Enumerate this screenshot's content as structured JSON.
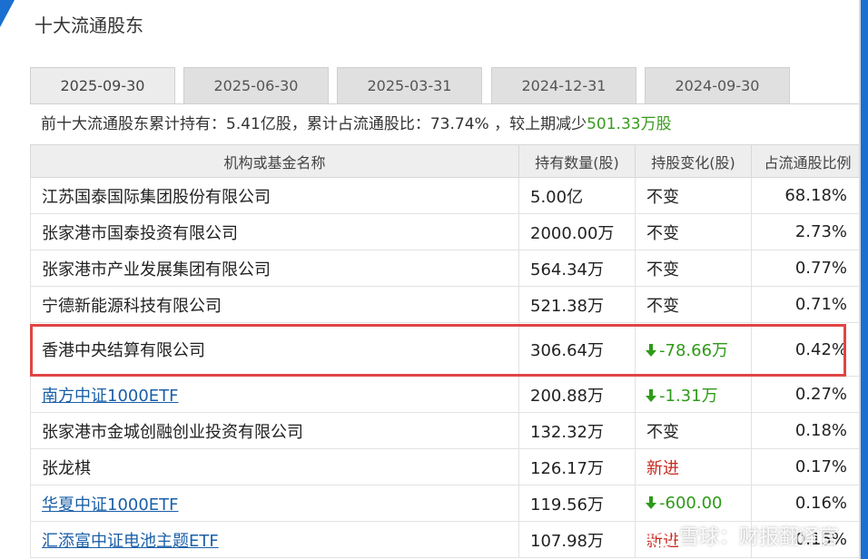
{
  "section_title": "十大流通股东",
  "tabs": [
    {
      "label": "2025-09-30",
      "active": true
    },
    {
      "label": "2025-06-30",
      "active": false
    },
    {
      "label": "2025-03-31",
      "active": false
    },
    {
      "label": "2024-12-31",
      "active": false
    },
    {
      "label": "2024-09-30",
      "active": false
    }
  ],
  "summary": {
    "prefix": "前十大流通股东累计持有：",
    "total_shares": "5.41亿股",
    "sep1": "，累计占流通股比：",
    "total_ratio": "73.74%",
    "sep2": " ，较上期减少",
    "decrease": "501.33万股"
  },
  "table": {
    "headers": [
      "机构或基金名称",
      "持有数量(股)",
      "持股变化(股)",
      "占流通股比例"
    ],
    "rows": [
      {
        "name": "江苏国泰国际集团股份有限公司",
        "link": false,
        "shares": "5.00亿",
        "change": "不变",
        "change_type": "same",
        "ratio": "68.18%"
      },
      {
        "name": "张家港市国泰投资有限公司",
        "link": false,
        "shares": "2000.00万",
        "change": "不变",
        "change_type": "same",
        "ratio": "2.73%"
      },
      {
        "name": "张家港市产业发展集团有限公司",
        "link": false,
        "shares": "564.34万",
        "change": "不变",
        "change_type": "same",
        "ratio": "0.77%"
      },
      {
        "name": "宁德新能源科技有限公司",
        "link": false,
        "shares": "521.38万",
        "change": "不变",
        "change_type": "same",
        "ratio": "0.71%"
      },
      {
        "name": "香港中央结算有限公司",
        "link": false,
        "shares": "306.64万",
        "change": "-78.66万",
        "change_type": "down",
        "ratio": "0.42%"
      },
      {
        "name": "南方中证1000ETF",
        "link": true,
        "shares": "200.88万",
        "change": "-1.31万",
        "change_type": "down",
        "ratio": "0.27%"
      },
      {
        "name": "张家港市金城创融创业投资有限公司",
        "link": false,
        "shares": "132.32万",
        "change": "不变",
        "change_type": "same",
        "ratio": "0.18%"
      },
      {
        "name": "张龙棋",
        "link": false,
        "shares": "126.17万",
        "change": "新进",
        "change_type": "new",
        "ratio": "0.17%"
      },
      {
        "name": "华夏中证1000ETF",
        "link": true,
        "shares": "119.56万",
        "change": "-600.00",
        "change_type": "down",
        "ratio": "0.16%"
      },
      {
        "name": "汇添富中证电池主题ETF",
        "link": true,
        "shares": "107.98万",
        "change": "新进",
        "change_type": "new",
        "ratio": "0.15%"
      }
    ]
  },
  "watermark": "雪球：财报翻译官",
  "colors": {
    "accent_blue": "#1a6fd0",
    "decrease_green": "#2e9a19",
    "new_red": "#c8281e",
    "highlight_red": "#e04545",
    "link_blue": "#1a5fa8"
  }
}
